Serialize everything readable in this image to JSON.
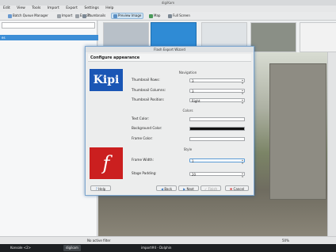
{
  "window": {
    "title": "digiKam"
  },
  "menu": [
    "Edit",
    "View",
    "Tools",
    "Import",
    "Export",
    "Settings",
    "Help"
  ],
  "toolbar": {
    "batch": "Batch Queue Manager",
    "import": "Import",
    "export": "Export",
    "thumbnails": "Thumbnails",
    "preview": "Preview Image",
    "map": "Map",
    "fullscreen": "Full Screen"
  },
  "sidebar": {
    "selected": "es"
  },
  "dialog": {
    "title": "Flash Export Wizard",
    "header": "Configure appearance",
    "kipi_logo": "Kipi",
    "flash_logo": "f",
    "sections": {
      "navigation": "Navigation",
      "colors": "Colors",
      "style": "Style"
    },
    "fields": {
      "thumb_rows_label": "Thumbnail Rows:",
      "thumb_rows_value": "3",
      "thumb_cols_label": "Thumbnail Columns:",
      "thumb_cols_value": "3",
      "thumb_pos_label": "Thumbnail Position:",
      "thumb_pos_value": "Right",
      "text_color_label": "Text Color:",
      "bg_color_label": "Background Color:",
      "frame_color_label": "Frame Color:",
      "frame_width_label": "Frame Width:",
      "frame_width_value": "1",
      "stage_padding_label": "Stage Padding:",
      "stage_padding_value": "20"
    },
    "buttons": {
      "help": "Help",
      "back": "Back",
      "next": "Next",
      "finish": "Finish",
      "cancel": "Cancel"
    }
  },
  "status": {
    "filter": "No active filter",
    "zoom": "50%"
  },
  "taskbar": {
    "app1": "digikam",
    "app2": "import#4 - Dolphin",
    "left": "Konsole <2>"
  }
}
